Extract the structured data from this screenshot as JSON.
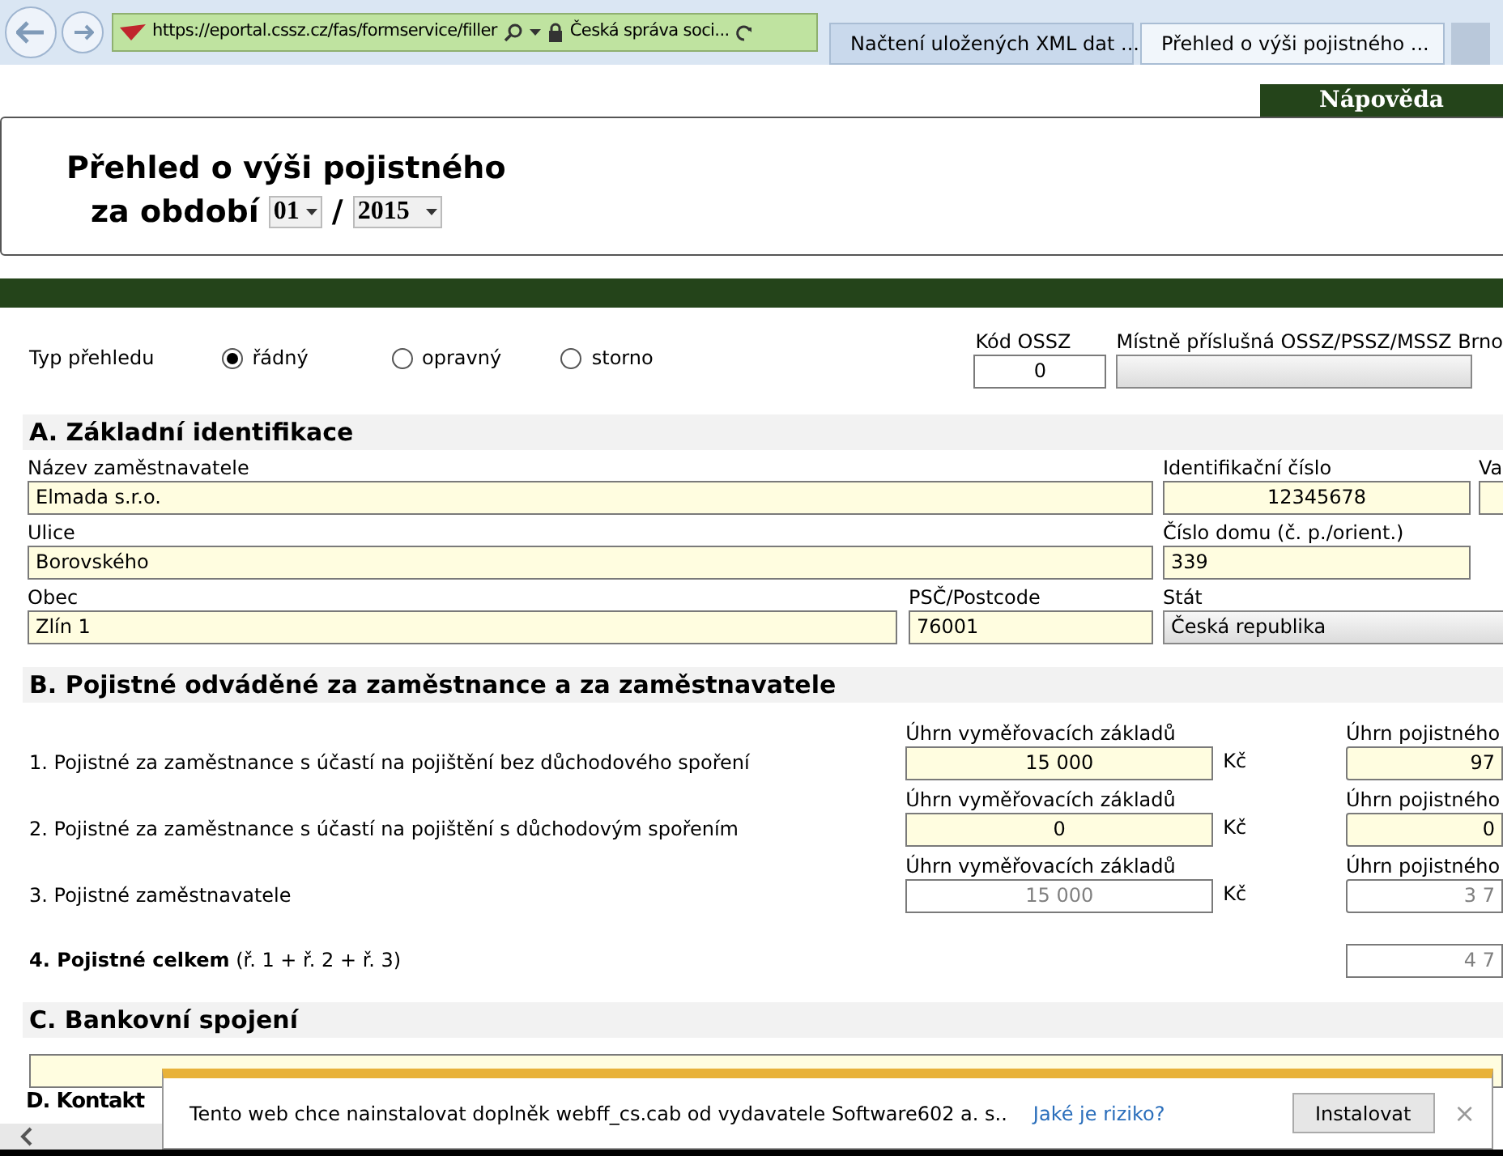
{
  "browser": {
    "url": "https://eportal.cssz.cz/fas/formservice/filler",
    "site_name": "Česká správa soci...",
    "tabs": [
      {
        "title": "Načtení uložených XML dat ...",
        "selected": false
      },
      {
        "title": "Přehled o výši pojistného ...",
        "selected": true
      }
    ]
  },
  "help_tab": "Nápověda",
  "header": {
    "title": "Přehled o výši pojistného",
    "period_label": "za období",
    "month": "01",
    "separator": "/",
    "year": "2015"
  },
  "report_type": {
    "label": "Typ přehledu",
    "options": [
      {
        "label": "řádný",
        "selected": true
      },
      {
        "label": "opravný",
        "selected": false
      },
      {
        "label": "storno",
        "selected": false
      }
    ]
  },
  "kod_ossz": {
    "label": "Kód OSSZ",
    "value": "0"
  },
  "local_office": {
    "label": "Místně příslušná OSSZ/PSSZ/MSSZ Brno"
  },
  "section_a": {
    "title": "A. Základní identifikace",
    "employer_name": {
      "label": "Název zaměstnavatele",
      "value": "Elmada s.r.o."
    },
    "id_number": {
      "label": "Identifikační číslo",
      "value": "12345678"
    },
    "column_3": {
      "label": "Va"
    },
    "street": {
      "label": "Ulice",
      "value": "Borovského"
    },
    "house_number": {
      "label": "Číslo domu (č. p./orient.)",
      "value": "339"
    },
    "city": {
      "label": "Obec",
      "value": "Zlín 1"
    },
    "postcode": {
      "label": "PSČ/Postcode",
      "value": "76001"
    },
    "country": {
      "label": "Stát",
      "value": "Česká republika"
    }
  },
  "section_b": {
    "title": "B. Pojistné odváděné za zaměstnance a za zaměstnavatele",
    "rows": [
      {
        "kind": "entry",
        "label": "1. Pojistné za zaměstnance s účastí na pojištění bez důchodového spoření",
        "base_label": "Úhrn vyměřovacích základů",
        "base_value": "15 000",
        "currency": "Kč",
        "premium_label": "Úhrn pojistného",
        "premium_value": "97",
        "editable": true
      },
      {
        "kind": "entry",
        "label": "2. Pojistné za zaměstnance s účastí na pojištění s důchodovým spořením",
        "base_label": "Úhrn vyměřovacích základů",
        "base_value": "0",
        "currency": "Kč",
        "premium_label": "Úhrn pojistného",
        "premium_value": "0",
        "editable": true
      },
      {
        "kind": "entry",
        "label": "3. Pojistné zaměstnavatele",
        "base_label": "Úhrn vyměřovacích základů",
        "base_value": "15 000",
        "currency": "Kč",
        "premium_label": "Úhrn pojistného",
        "premium_value": "3 7",
        "editable": false
      },
      {
        "kind": "total",
        "label": "**4. Pojistné celkem** (ř. 1 + ř. 2 + ř. 3)",
        "premium_value": "4 7",
        "editable": false
      }
    ]
  },
  "section_c": {
    "title": "C. Bankovní spojení"
  },
  "section_d": {
    "title": "D. Kontakt"
  },
  "notification": {
    "message": "Tento web chce nainstalovat doplněk webff_cs.cab od vydavatele Software602 a. s..",
    "link": "Jaké je riziko?",
    "button": "Instalovat",
    "close": "×"
  }
}
